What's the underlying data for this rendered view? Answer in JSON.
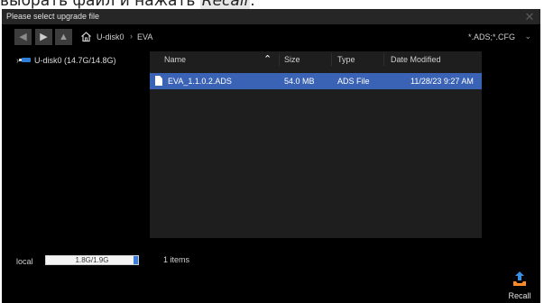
{
  "caption": {
    "prefix": "выбрать файл и нажать ",
    "highlight": "Recall",
    "suffix": "."
  },
  "dialog": {
    "title": "Please select upgrade file",
    "close_label": "✕"
  },
  "nav": {
    "back_icon": "◀",
    "forward_icon": "▶",
    "up_icon": "▲",
    "breadcrumb": [
      "U-disk0",
      "EVA"
    ],
    "separator": "›",
    "filter": "*.ADS;*.CFG",
    "filter_caret": "⌄"
  },
  "tree": {
    "items": [
      {
        "label": "U-disk0  (14.7G/14.8G)",
        "chevron": "›",
        "icon": "usb-drive-icon"
      }
    ]
  },
  "files": {
    "columns": [
      "Name",
      "Size",
      "Type",
      "Date Modified"
    ],
    "sort_indicator": "⌃",
    "rows": [
      {
        "name": "EVA_1.1.0.2.ADS",
        "size": "54.0 MB",
        "type": "ADS File",
        "date": "11/28/23 9:27 AM",
        "selected": true
      }
    ]
  },
  "footer": {
    "local_label": "local",
    "storage_text": "1.8G/1.9G",
    "storage_used_fraction": 0.95,
    "item_count": "1 items"
  },
  "actions": {
    "recall_label": "Recall",
    "recall_icon": "recall-upload-icon"
  },
  "colors": {
    "selection": "#3b63b5",
    "accent": "#2d7fd8"
  }
}
